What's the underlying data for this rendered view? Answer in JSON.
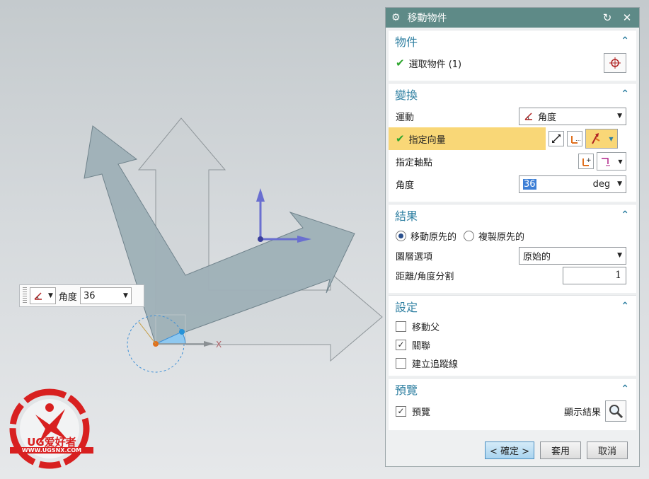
{
  "dialog": {
    "title": "移動物件",
    "sections": {
      "object": {
        "title": "物件",
        "select_label": "選取物件 (1)"
      },
      "transform": {
        "title": "變換",
        "motion_label": "運動",
        "motion_value": "角度",
        "vector_label": "指定向量",
        "pivot_label": "指定軸點",
        "angle_label": "角度",
        "angle_value": "36",
        "angle_unit": "deg"
      },
      "result": {
        "title": "結果",
        "move_original": "移動原先的",
        "copy_original": "複製原先的",
        "layer_label": "圖層選項",
        "layer_value": "原始的",
        "split_label": "距離/角度分割",
        "split_value": "1"
      },
      "settings": {
        "title": "設定",
        "move_parent": "移動父",
        "associative": "關聯",
        "create_trace": "建立追蹤線"
      },
      "preview": {
        "title": "預覽",
        "preview_label": "預覽",
        "show_result": "顯示結果"
      }
    },
    "buttons": {
      "ok": "< 確定 >",
      "apply": "套用",
      "cancel": "取消"
    }
  },
  "float_toolbar": {
    "label": "角度",
    "value": "36"
  },
  "viewport": {
    "axis_x_label": "X"
  },
  "logo": {
    "brand": "UG爱好者",
    "url": "WWW.UGSNX.COM"
  },
  "colors": {
    "titlebar": "#5e8a87",
    "accent": "#2e7fa1",
    "highlight": "#f9d777",
    "check": "#2ea62e"
  }
}
